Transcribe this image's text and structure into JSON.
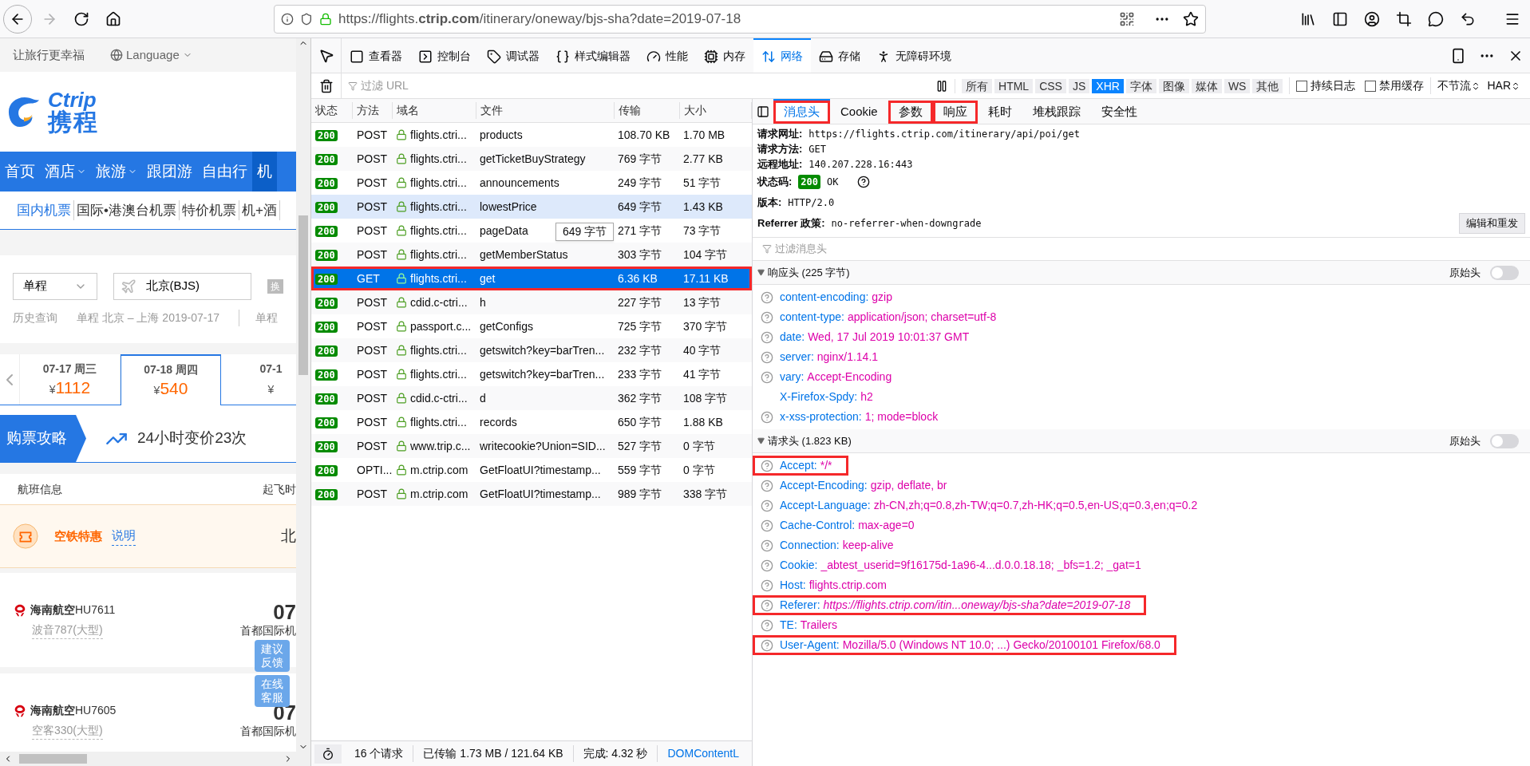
{
  "browser": {
    "url": "https://flights.**ctrip.com**/itinerary/oneway/bjs-sha?date=2019-07-18"
  },
  "page": {
    "slogan": "让旅行更幸福",
    "language": "Language",
    "logo": {
      "latin": "Ctrip",
      "chinese": "携程"
    },
    "nav": [
      {
        "label": "首页",
        "dropdown": false,
        "selected": false
      },
      {
        "label": "酒店",
        "dropdown": true,
        "selected": false
      },
      {
        "label": "旅游",
        "dropdown": true,
        "selected": false
      },
      {
        "label": "跟团游",
        "dropdown": false,
        "selected": false
      },
      {
        "label": "自由行",
        "dropdown": false,
        "selected": false
      },
      {
        "label": "机",
        "dropdown": false,
        "selected": true
      }
    ],
    "subnav": [
      {
        "label": "国内机票",
        "selected": true
      },
      {
        "label": "国际•港澳台机票",
        "selected": false
      },
      {
        "label": "特价机票",
        "selected": false
      },
      {
        "label": "机+酒",
        "selected": false
      }
    ],
    "trip_type": "单程",
    "from": "北京(BJS)",
    "swap": "换",
    "history": {
      "label": "历史查询",
      "entry": "单程 北京 – 上海  2019-07-17",
      "next": "单程"
    },
    "dates": [
      {
        "date": "07-17 周三",
        "currency": "¥",
        "price": "1112",
        "selected": false
      },
      {
        "date": "07-18 周四",
        "currency": "¥",
        "price": "540",
        "selected": true
      },
      {
        "date": "07-1",
        "currency": "¥",
        "selected": false
      }
    ],
    "strategy": {
      "label": "购票攻略",
      "trend": "24小时变价23次"
    },
    "columns": [
      "航班信息",
      "起飞时"
    ],
    "promo": {
      "title": "空铁特惠",
      "link": "说明",
      "city": "北"
    },
    "flights": [
      {
        "airline": "海南航空",
        "number": "HU7611",
        "aircraft": "波音787(大型)",
        "time": "07",
        "airport": "首都国际机"
      },
      {
        "airline": "海南航空",
        "number": "HU7605",
        "aircraft": "空客330(大型)",
        "time": "07",
        "airport": "首都国际机"
      }
    ],
    "float_buttons": [
      "建议反馈",
      "在线客服"
    ]
  },
  "devtools": {
    "tools": [
      {
        "label": "查看器",
        "selected": false
      },
      {
        "label": "控制台",
        "selected": false
      },
      {
        "label": "调试器",
        "selected": false
      },
      {
        "label": "样式编辑器",
        "selected": false
      },
      {
        "label": "性能",
        "selected": false
      },
      {
        "label": "内存",
        "selected": false
      },
      {
        "label": "网络",
        "selected": true
      },
      {
        "label": "存储",
        "selected": false
      },
      {
        "label": "无障碍环境",
        "selected": false
      }
    ],
    "filter_placeholder": "过滤 URL",
    "types": [
      {
        "label": "所有",
        "selected": false
      },
      {
        "label": "HTML",
        "selected": false
      },
      {
        "label": "CSS",
        "selected": false
      },
      {
        "label": "JS",
        "selected": false
      },
      {
        "label": "XHR",
        "selected": true
      },
      {
        "label": "字体",
        "selected": false
      },
      {
        "label": "图像",
        "selected": false
      },
      {
        "label": "媒体",
        "selected": false
      },
      {
        "label": "WS",
        "selected": false
      },
      {
        "label": "其他",
        "selected": false
      }
    ],
    "options": [
      {
        "label": "持续日志",
        "checked": false
      },
      {
        "label": "禁用缓存",
        "checked": false
      }
    ],
    "throttle": "不节流",
    "har": "HAR",
    "columns": [
      "状态",
      "方法",
      "域名",
      "文件",
      "传输",
      "大小"
    ],
    "requests": [
      {
        "status": "200",
        "method": "POST",
        "domain": "flights.ctri...",
        "file": "products",
        "transferred": "108.70 KB",
        "size": "1.70 MB",
        "selected": false,
        "hovered": false,
        "annotated": false
      },
      {
        "status": "200",
        "method": "POST",
        "domain": "flights.ctri...",
        "file": "getTicketBuyStrategy",
        "transferred": "769 字节",
        "size": "2.77 KB",
        "selected": false,
        "hovered": false,
        "annotated": false
      },
      {
        "status": "200",
        "method": "POST",
        "domain": "flights.ctri...",
        "file": "announcements",
        "transferred": "249 字节",
        "size": "51 字节",
        "selected": false,
        "hovered": false,
        "annotated": false
      },
      {
        "status": "200",
        "method": "POST",
        "domain": "flights.ctri...",
        "file": "lowestPrice",
        "transferred": "649 字节",
        "size": "1.43 KB",
        "selected": false,
        "hovered": true,
        "annotated": false
      },
      {
        "status": "200",
        "method": "POST",
        "domain": "flights.ctri...",
        "file": "pageData",
        "transferred": "271 字节",
        "size": "73 字节",
        "selected": false,
        "hovered": false,
        "annotated": false
      },
      {
        "status": "200",
        "method": "POST",
        "domain": "flights.ctri...",
        "file": "getMemberStatus",
        "transferred": "303 字节",
        "size": "104 字节",
        "selected": false,
        "hovered": false,
        "annotated": false
      },
      {
        "status": "200",
        "method": "GET",
        "domain": "flights.ctri...",
        "file": "get",
        "transferred": "6.36 KB",
        "size": "17.11 KB",
        "selected": true,
        "hovered": false,
        "annotated": true
      },
      {
        "status": "200",
        "method": "POST",
        "domain": "cdid.c-ctri...",
        "file": "h",
        "transferred": "227 字节",
        "size": "13 字节",
        "selected": false,
        "hovered": false,
        "annotated": false
      },
      {
        "status": "200",
        "method": "POST",
        "domain": "passport.c...",
        "file": "getConfigs",
        "transferred": "725 字节",
        "size": "370 字节",
        "selected": false,
        "hovered": false,
        "annotated": false
      },
      {
        "status": "200",
        "method": "POST",
        "domain": "flights.ctri...",
        "file": "getswitch?key=barTren...",
        "transferred": "232 字节",
        "size": "40 字节",
        "selected": false,
        "hovered": false,
        "annotated": false
      },
      {
        "status": "200",
        "method": "POST",
        "domain": "flights.ctri...",
        "file": "getswitch?key=barTren...",
        "transferred": "233 字节",
        "size": "41 字节",
        "selected": false,
        "hovered": false,
        "annotated": false
      },
      {
        "status": "200",
        "method": "POST",
        "domain": "cdid.c-ctri...",
        "file": "d",
        "transferred": "362 字节",
        "size": "108 字节",
        "selected": false,
        "hovered": false,
        "annotated": false
      },
      {
        "status": "200",
        "method": "POST",
        "domain": "flights.ctri...",
        "file": "records",
        "transferred": "650 字节",
        "size": "1.88 KB",
        "selected": false,
        "hovered": false,
        "annotated": false
      },
      {
        "status": "200",
        "method": "POST",
        "domain": "www.trip.c...",
        "file": "writecookie?Union=SID...",
        "transferred": "527 字节",
        "size": "0 字节",
        "selected": false,
        "hovered": false,
        "annotated": false
      },
      {
        "status": "200",
        "method": "OPTI...",
        "domain": "m.ctrip.com",
        "file": "GetFloatUI?timestamp...",
        "transferred": "559 字节",
        "size": "0 字节",
        "selected": false,
        "hovered": false,
        "annotated": false
      },
      {
        "status": "200",
        "method": "POST",
        "domain": "m.ctrip.com",
        "file": "GetFloatUI?timestamp...",
        "transferred": "989 字节",
        "size": "338 字节",
        "selected": false,
        "hovered": false,
        "annotated": false
      }
    ],
    "tooltip": "649 字节",
    "summary": {
      "requests": "16 个请求",
      "transferred": "已传输 1.73 MB / 121.64 KB",
      "finish": "完成: 4.32 秒",
      "dom": "DOMContentL"
    },
    "detail_tabs": [
      {
        "label": "消息头",
        "selected": true,
        "annotated": true
      },
      {
        "label": "Cookie",
        "selected": false,
        "annotated": false
      },
      {
        "label": "参数",
        "selected": false,
        "annotated": true
      },
      {
        "label": "响应",
        "selected": false,
        "annotated": true
      },
      {
        "label": "耗时",
        "selected": false,
        "annotated": false
      },
      {
        "label": "堆栈跟踪",
        "selected": false,
        "annotated": false
      },
      {
        "label": "安全性",
        "selected": false,
        "annotated": false
      }
    ],
    "general": [
      {
        "kind": "plain",
        "label": "请求网址:",
        "value": "https://flights.ctrip.com/itinerary/api/poi/get"
      },
      {
        "kind": "plain",
        "label": "请求方法:",
        "value": "GET"
      },
      {
        "kind": "plain",
        "label": "远程地址:",
        "value": "140.207.228.16:443"
      },
      {
        "kind": "status",
        "label": "状态码:",
        "code": "200",
        "value": "OK"
      },
      {
        "kind": "plain",
        "label": "版本:",
        "value": "HTTP/2.0"
      },
      {
        "kind": "plain",
        "label": "Referrer 政策:",
        "value": "no-referrer-when-downgrade"
      }
    ],
    "resend": "编辑和重发",
    "header_filter": "过滤消息头",
    "sections": [
      {
        "title": "响应头 (225 字节)",
        "expanded": true,
        "raw_label": "原始头",
        "raw": false,
        "headers": [
          {
            "name": "content-encoding:",
            "value": "gzip",
            "help": true,
            "italic": false,
            "annotated": false
          },
          {
            "name": "content-type:",
            "value": "application/json; charset=utf-8",
            "help": true,
            "italic": false,
            "annotated": false
          },
          {
            "name": "date:",
            "value": "Wed, 17 Jul 2019 10:01:37 GMT",
            "help": true,
            "italic": false,
            "annotated": false
          },
          {
            "name": "server:",
            "value": "nginx/1.14.1",
            "help": true,
            "italic": false,
            "annotated": false
          },
          {
            "name": "vary:",
            "value": "Accept-Encoding",
            "help": true,
            "italic": false,
            "annotated": false
          },
          {
            "name": "X-Firefox-Spdy:",
            "value": "h2",
            "help": false,
            "italic": false,
            "annotated": false
          },
          {
            "name": "x-xss-protection:",
            "value": "1; mode=block",
            "help": true,
            "italic": false,
            "annotated": false
          }
        ]
      },
      {
        "title": "请求头 (1.823 KB)",
        "expanded": true,
        "raw_label": "原始头",
        "raw": false,
        "headers": [
          {
            "name": "Accept:",
            "value": "*/*",
            "help": true,
            "italic": false,
            "annotated": true
          },
          {
            "name": "Accept-Encoding:",
            "value": "gzip, deflate, br",
            "help": true,
            "italic": false,
            "annotated": false
          },
          {
            "name": "Accept-Language:",
            "value": "zh-CN,zh;q=0.8,zh-TW;q=0.7,zh-HK;q=0.5,en-US;q=0.3,en;q=0.2",
            "help": true,
            "italic": false,
            "annotated": false
          },
          {
            "name": "Cache-Control:",
            "value": "max-age=0",
            "help": true,
            "italic": false,
            "annotated": false
          },
          {
            "name": "Connection:",
            "value": "keep-alive",
            "help": true,
            "italic": false,
            "annotated": false
          },
          {
            "name": "Cookie:",
            "value": "_abtest_userid=9f16175d-1a96-4...d.0.0.18.18; _bfs=1.2; _gat=1",
            "help": true,
            "italic": false,
            "annotated": false
          },
          {
            "name": "Host:",
            "value": "flights.ctrip.com",
            "help": true,
            "italic": false,
            "annotated": false
          },
          {
            "name": "Referer:",
            "value": "https://flights.ctrip.com/itin...oneway/bjs-sha?date=2019-07-18",
            "help": true,
            "italic": true,
            "annotated": true
          },
          {
            "name": "TE:",
            "value": "Trailers",
            "help": true,
            "italic": false,
            "annotated": false
          },
          {
            "name": "User-Agent:",
            "value": "Mozilla/5.0 (Windows NT 10.0; ...) Gecko/20100101 Firefox/68.0",
            "help": true,
            "italic": false,
            "annotated": true
          }
        ]
      }
    ]
  }
}
